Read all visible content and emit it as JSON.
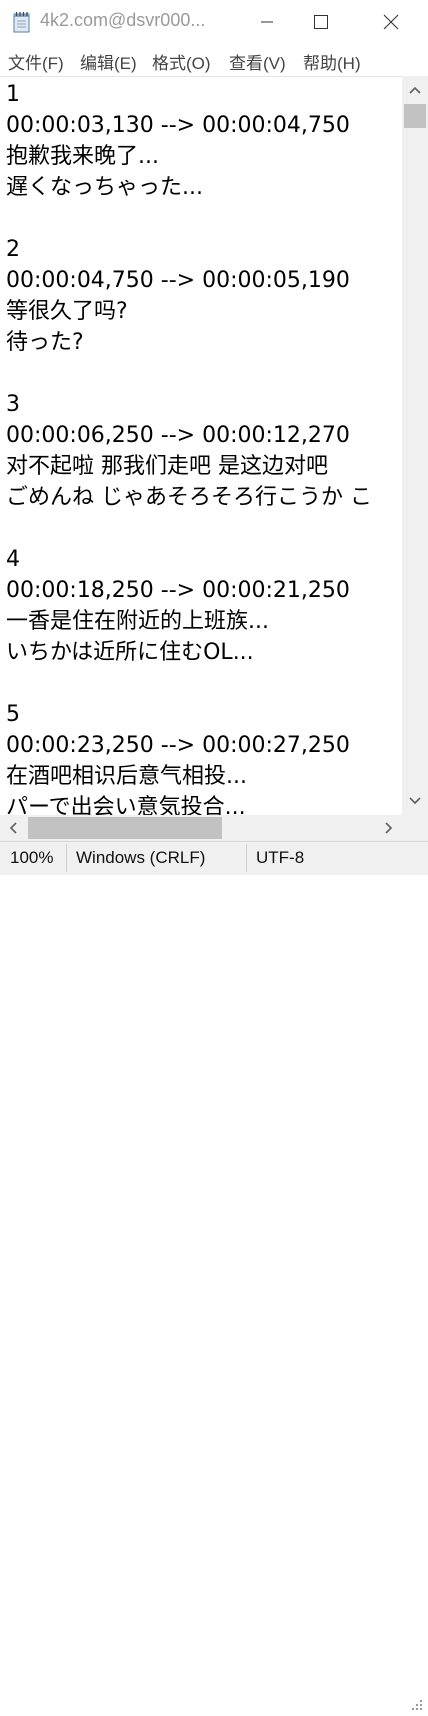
{
  "window": {
    "title": "4k2.com@dsvr000...",
    "controls": {
      "minimize": "—",
      "maximize": "☐",
      "close": "✕"
    }
  },
  "menu": [
    {
      "label": "文件(F)"
    },
    {
      "label": "编辑(E)"
    },
    {
      "label": "格式(O)"
    },
    {
      "label": "查看(V)"
    },
    {
      "label": "帮助(H)"
    }
  ],
  "document": {
    "content": "1\n00:00:03,130 --> 00:00:04,750\n抱歉我来晚了...\n遅くなっちゃった...\n\n2\n00:00:04,750 --> 00:00:05,190\n等很久了吗?\n待った?\n\n3\n00:00:06,250 --> 00:00:12,270\n对不起啦 那我们走吧 是这边对吧\nごめんね じゃあそろそろ行こうか こ\n\n4\n00:00:18,250 --> 00:00:21,250\n一香是住在附近的上班族...\nいちかは近所に住むOL...\n\n5\n00:00:23,250 --> 00:00:27,250\n在酒吧相识后意气相投...\nパーで出会い意気投合..."
  },
  "status": {
    "zoom": "100%",
    "line_ending": "Windows (CRLF)",
    "encoding": "UTF-8"
  },
  "icons": {
    "app": "notepad-icon",
    "grip": "resize-grip-icon"
  },
  "colors": {
    "scroll_track": "#f0f0f0",
    "scroll_thumb": "#c2c2c2",
    "status_bg": "#f0f0f0"
  }
}
